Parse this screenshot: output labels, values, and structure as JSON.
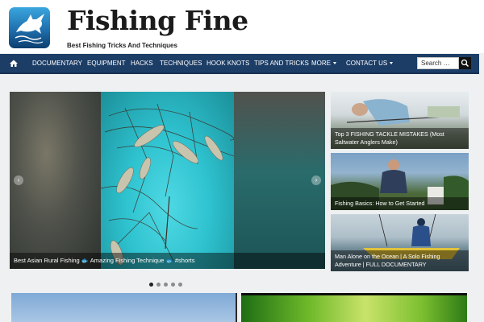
{
  "site": {
    "title": "Fishing Fine",
    "tagline": "Best Fishing Tricks And Techniques"
  },
  "nav": {
    "items": [
      {
        "label": "DOCUMENTARY",
        "dropdown": false
      },
      {
        "label": "EQUIPMENT",
        "dropdown": false
      },
      {
        "label": "HACKS",
        "dropdown": false
      },
      {
        "label": "TECHNIQUES",
        "dropdown": false
      },
      {
        "label": "HOOK KNOTS",
        "dropdown": false
      },
      {
        "label": "TIPS AND TRICKS",
        "dropdown": false
      },
      {
        "label": "MORE",
        "dropdown": true
      },
      {
        "label": "CONTACT US",
        "dropdown": true
      }
    ],
    "search_placeholder": "Search …"
  },
  "slider": {
    "caption": "Best Asian Rural Fishing 🐟 Amazing Fishing Technique 🐟 #shorts",
    "dot_count": 5,
    "active_dot": 1
  },
  "side_posts": [
    {
      "title": "Top 3 FISHING TACKLE MISTAKES (Most Saltwater Anglers Make)"
    },
    {
      "title": "Fishing Basics: How to Get Started"
    },
    {
      "title": "Man Alone on the Ocean | A Solo Fishing Adventure | FULL DOCUMENTARY"
    }
  ],
  "colors": {
    "nav_bg": "#1c3d66",
    "page_bg": "#eef0f2"
  }
}
